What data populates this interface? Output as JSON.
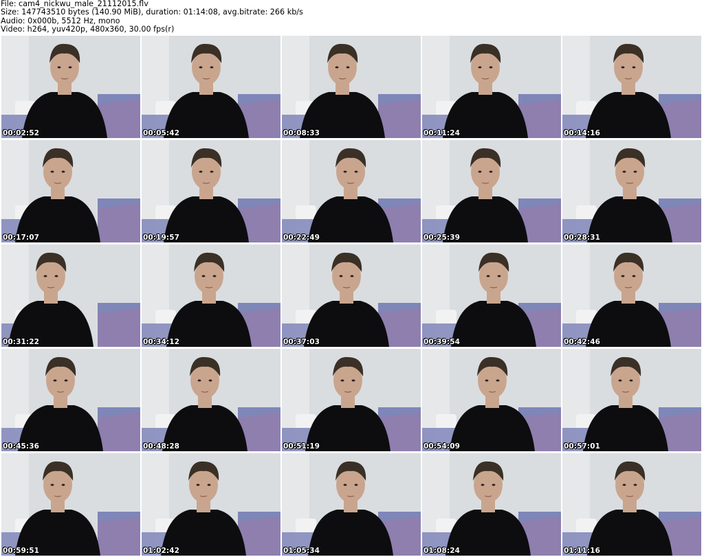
{
  "header": {
    "file_line": "File: cam4_nickwu_male_21112015.flv",
    "size_line": "Size: 147743510 bytes (140.90 MiB), duration: 01:14:08, avg.bitrate: 266 kb/s",
    "audio_line": "Audio: 0x000b, 5512 Hz, mono",
    "video_line": "Video: h264, yuv420p, 480x360, 30.00 fps(r)"
  },
  "colors": {
    "wall": "#d9dde0",
    "shirt": "#0d0d0f",
    "skin": "#c9a58e",
    "hair": "#3a3026",
    "bedding": "#7f86b8",
    "pillow": "#f2f2f2"
  },
  "thumbnails": [
    {
      "timestamp": "00:02:52"
    },
    {
      "timestamp": "00:05:42"
    },
    {
      "timestamp": "00:08:33"
    },
    {
      "timestamp": "00:11:24"
    },
    {
      "timestamp": "00:14:16"
    },
    {
      "timestamp": "00:17:07"
    },
    {
      "timestamp": "00:19:57"
    },
    {
      "timestamp": "00:22:49"
    },
    {
      "timestamp": "00:25:39"
    },
    {
      "timestamp": "00:28:31"
    },
    {
      "timestamp": "00:31:22"
    },
    {
      "timestamp": "00:34:12"
    },
    {
      "timestamp": "00:37:03"
    },
    {
      "timestamp": "00:39:54"
    },
    {
      "timestamp": "00:42:46"
    },
    {
      "timestamp": "00:45:36"
    },
    {
      "timestamp": "00:48:28"
    },
    {
      "timestamp": "00:51:19"
    },
    {
      "timestamp": "00:54:09"
    },
    {
      "timestamp": "00:57:01"
    },
    {
      "timestamp": "00:59:51"
    },
    {
      "timestamp": "01:02:42"
    },
    {
      "timestamp": "01:05:34"
    },
    {
      "timestamp": "01:08:24"
    },
    {
      "timestamp": "01:11:16"
    }
  ]
}
